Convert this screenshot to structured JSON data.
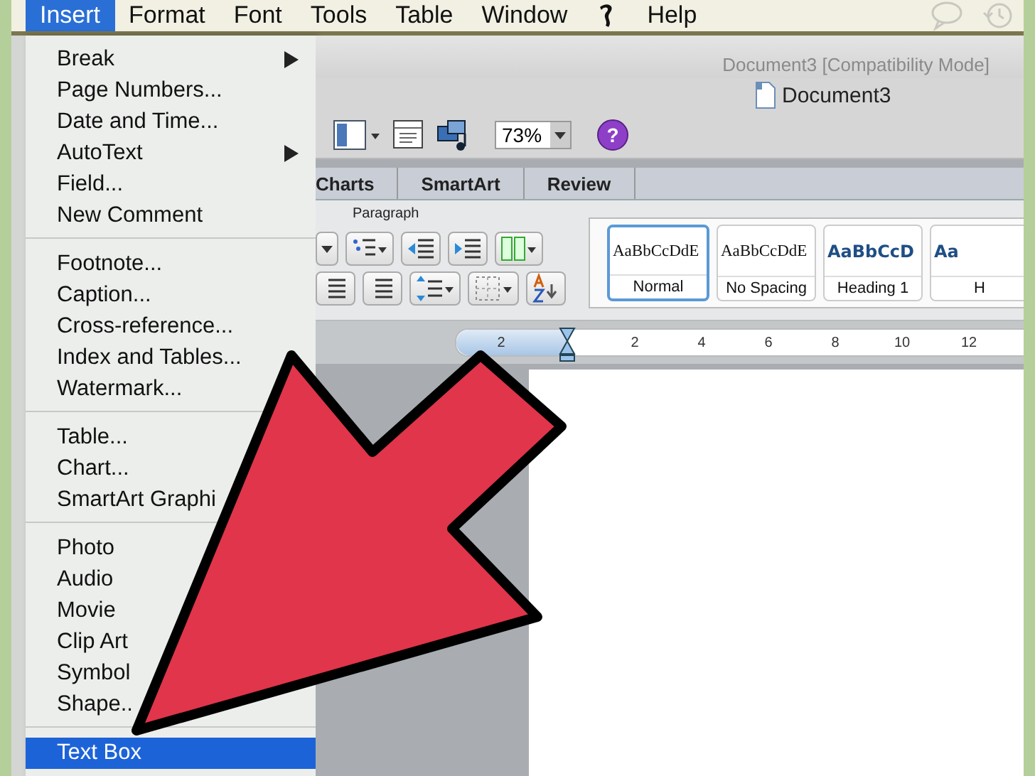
{
  "menubar": {
    "items": [
      {
        "kind": "text",
        "label": "Insert",
        "selected": true
      },
      {
        "kind": "text",
        "label": "Format",
        "selected": false
      },
      {
        "kind": "text",
        "label": "Font",
        "selected": false
      },
      {
        "kind": "text",
        "label": "Tools",
        "selected": false
      },
      {
        "kind": "text",
        "label": "Table",
        "selected": false
      },
      {
        "kind": "text",
        "label": "Window",
        "selected": false
      },
      {
        "kind": "icon",
        "selected": false
      },
      {
        "kind": "text",
        "label": "Help",
        "selected": false
      }
    ]
  },
  "menu": {
    "groups": [
      {
        "items": [
          {
            "label": "Break",
            "submenu": true,
            "selected": false
          },
          {
            "label": "Page Numbers...",
            "submenu": false,
            "selected": false
          },
          {
            "label": "Date and Time...",
            "submenu": false,
            "selected": false
          },
          {
            "label": "AutoText",
            "submenu": true,
            "selected": false
          },
          {
            "label": "Field...",
            "submenu": false,
            "selected": false
          },
          {
            "label": "New Comment",
            "submenu": false,
            "selected": false
          }
        ]
      },
      {
        "items": [
          {
            "label": "Footnote...",
            "submenu": false,
            "selected": false
          },
          {
            "label": "Caption...",
            "submenu": false,
            "selected": false
          },
          {
            "label": "Cross-reference...",
            "submenu": false,
            "selected": false
          },
          {
            "label": "Index and Tables...",
            "submenu": false,
            "selected": false
          },
          {
            "label": "Watermark...",
            "submenu": false,
            "selected": false
          }
        ]
      },
      {
        "items": [
          {
            "label": "Table...",
            "submenu": false,
            "selected": false
          },
          {
            "label": "Chart...",
            "submenu": false,
            "selected": false
          },
          {
            "label": "SmartArt Graphi",
            "submenu": false,
            "selected": false
          }
        ]
      },
      {
        "items": [
          {
            "label": "Photo",
            "submenu": false,
            "selected": false
          },
          {
            "label": "Audio",
            "submenu": false,
            "selected": false
          },
          {
            "label": "Movie",
            "submenu": false,
            "selected": false
          },
          {
            "label": "Clip Art",
            "submenu": false,
            "selected": false
          },
          {
            "label": "Symbol",
            "submenu": false,
            "selected": false
          },
          {
            "label": "Shape..",
            "submenu": false,
            "selected": false
          }
        ]
      },
      {
        "items": [
          {
            "label": "Text Box",
            "submenu": false,
            "selected": true
          }
        ]
      }
    ]
  },
  "window": {
    "background_title": "Document3 [Compatibility Mode]",
    "title": "Document3"
  },
  "toolbar": {
    "zoom": "73%",
    "help": "?"
  },
  "ribbon": {
    "tabs": [
      {
        "label": "Charts",
        "selected": false
      },
      {
        "label": "SmartArt",
        "selected": false
      },
      {
        "label": "Review",
        "selected": false
      }
    ],
    "group_label": "Paragraph",
    "styles": [
      {
        "kind": "body",
        "preview": "AaBbCcDdE",
        "label": "Normal",
        "selected": true
      },
      {
        "kind": "body",
        "preview": "AaBbCcDdE",
        "label": "No Spacing",
        "selected": false
      },
      {
        "kind": "heading",
        "preview": "AaBbCcD",
        "label": "Heading 1",
        "selected": false
      },
      {
        "kind": "heading",
        "preview": "Aa",
        "label": "H",
        "selected": false
      }
    ]
  },
  "ruler": {
    "labels": [
      "2",
      "2",
      "4",
      "6",
      "8",
      "10",
      "12"
    ]
  }
}
